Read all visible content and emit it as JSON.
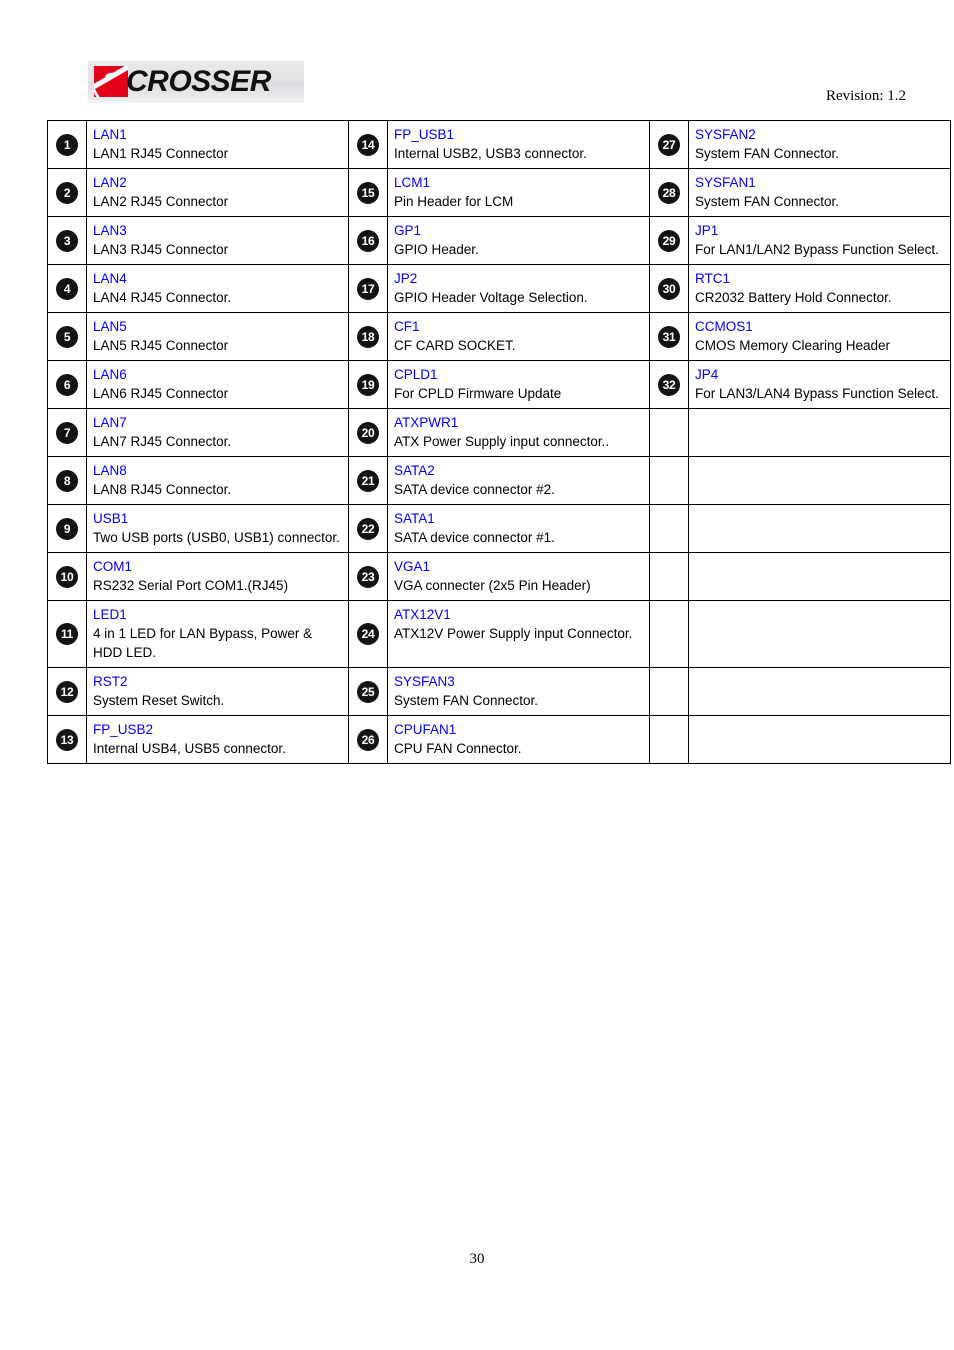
{
  "header": {
    "logo_mark": "acrosser-logo",
    "logo_letter": "a",
    "logo_text": "CROSSER",
    "revision": "Revision: 1.2"
  },
  "footer": {
    "page_number": "30"
  },
  "table": {
    "rows": [
      {
        "c1": {
          "num": "1",
          "label": "LAN1",
          "desc": "LAN1 RJ45 Connector"
        },
        "c2": {
          "num": "14",
          "label": "FP_USB1",
          "desc": "Internal USB2, USB3 connector."
        },
        "c3": {
          "num": "27",
          "label": "SYSFAN2",
          "desc": "System FAN Connector."
        }
      },
      {
        "c1": {
          "num": "2",
          "label": "LAN2",
          "desc": "LAN2 RJ45 Connector"
        },
        "c2": {
          "num": "15",
          "label": "LCM1",
          "desc": "Pin Header for LCM"
        },
        "c3": {
          "num": "28",
          "label": "SYSFAN1",
          "desc": "System FAN Connector."
        }
      },
      {
        "c1": {
          "num": "3",
          "label": "LAN3",
          "desc": "LAN3 RJ45 Connector"
        },
        "c2": {
          "num": "16",
          "label": "GP1",
          "desc": "GPIO Header."
        },
        "c3": {
          "num": "29",
          "label": "JP1",
          "desc": "For LAN1/LAN2 Bypass Function Select."
        }
      },
      {
        "c1": {
          "num": "4",
          "label": "LAN4",
          "desc": "LAN4 RJ45 Connector."
        },
        "c2": {
          "num": "17",
          "label": "JP2",
          "desc": "GPIO Header Voltage Selection."
        },
        "c3": {
          "num": "30",
          "label": "RTC1",
          "desc": "CR2032 Battery Hold Connector."
        }
      },
      {
        "c1": {
          "num": "5",
          "label": "LAN5",
          "desc": "LAN5 RJ45 Connector"
        },
        "c2": {
          "num": "18",
          "label": "CF1",
          "desc": "CF CARD SOCKET."
        },
        "c3": {
          "num": "31",
          "label": "CCMOS1",
          "desc": "CMOS Memory Clearing Header"
        }
      },
      {
        "c1": {
          "num": "6",
          "label": "LAN6",
          "desc": "LAN6 RJ45 Connector"
        },
        "c2": {
          "num": "19",
          "label": "CPLD1",
          "desc": "For CPLD Firmware Update"
        },
        "c3": {
          "num": "32",
          "label": "JP4",
          "desc": "For LAN3/LAN4 Bypass Function Select."
        }
      },
      {
        "c1": {
          "num": "7",
          "label": "LAN7",
          "desc": "LAN7 RJ45 Connector."
        },
        "c2": {
          "num": "20",
          "label": "ATXPWR1",
          "desc": "ATX Power Supply input connector.."
        },
        "c3": {
          "num": "",
          "label": "",
          "desc": ""
        }
      },
      {
        "c1": {
          "num": "8",
          "label": "LAN8",
          "desc": "LAN8 RJ45 Connector."
        },
        "c2": {
          "num": "21",
          "label": "SATA2",
          "desc": "SATA device connector #2."
        },
        "c3": {
          "num": "",
          "label": "",
          "desc": ""
        }
      },
      {
        "c1": {
          "num": "9",
          "label": "USB1",
          "desc": "Two USB ports (USB0, USB1) connector."
        },
        "c2": {
          "num": "22",
          "label": "SATA1",
          "desc": "SATA device connector #1."
        },
        "c3": {
          "num": "",
          "label": "",
          "desc": ""
        }
      },
      {
        "c1": {
          "num": "10",
          "label": "COM1",
          "desc": "RS232 Serial Port COM1.(RJ45)"
        },
        "c2": {
          "num": "23",
          "label": "VGA1",
          "desc": "VGA connecter (2x5 Pin Header)"
        },
        "c3": {
          "num": "",
          "label": "",
          "desc": ""
        }
      },
      {
        "c1": {
          "num": "11",
          "label": "LED1",
          "desc": "4 in 1 LED for LAN Bypass, Power & HDD LED."
        },
        "c2": {
          "num": "24",
          "label": "ATX12V1",
          "desc": "ATX12V Power Supply input Connector."
        },
        "c3": {
          "num": "",
          "label": "",
          "desc": ""
        }
      },
      {
        "c1": {
          "num": "12",
          "label": "RST2",
          "desc": "System Reset Switch."
        },
        "c2": {
          "num": "25",
          "label": "SYSFAN3",
          "desc": "System FAN Connector."
        },
        "c3": {
          "num": "",
          "label": "",
          "desc": ""
        }
      },
      {
        "c1": {
          "num": "13",
          "label": "FP_USB2",
          "desc": "Internal USB4, USB5 connector."
        },
        "c2": {
          "num": "26",
          "label": "CPUFAN1",
          "desc": "CPU FAN Connector."
        },
        "c3": {
          "num": "",
          "label": "",
          "desc": ""
        }
      }
    ]
  }
}
